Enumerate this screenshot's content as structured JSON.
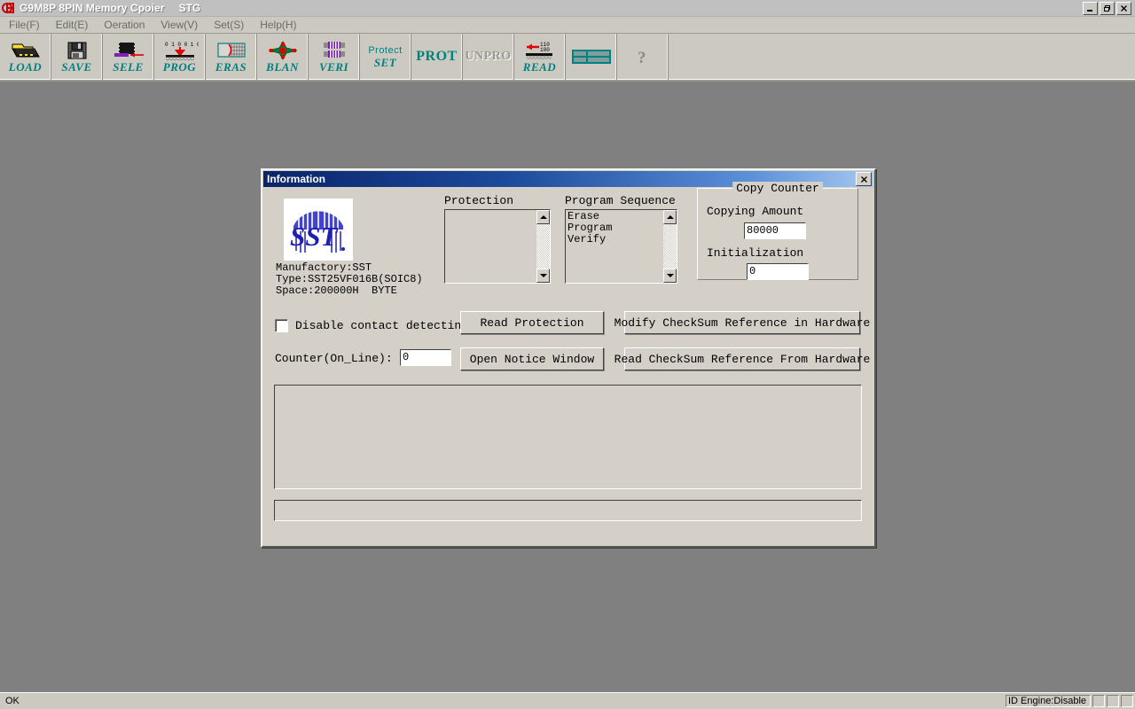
{
  "window": {
    "title": "G9M8P 8PIN Memory Cpoier",
    "subtitle": "STG",
    "app_icon": "app-logo-icon",
    "minimize_label": "_",
    "restore_label": "❐",
    "close_label": "✕"
  },
  "menubar": {
    "items": [
      {
        "label": "File(F)",
        "name": "menu-file"
      },
      {
        "label": "Edit(E)",
        "name": "menu-edit"
      },
      {
        "label": "Oeration",
        "name": "menu-operation"
      },
      {
        "label": "View(V)",
        "name": "menu-view"
      },
      {
        "label": "Set(S)",
        "name": "menu-set"
      },
      {
        "label": "Help(H)",
        "name": "menu-help"
      }
    ]
  },
  "toolbar": {
    "buttons": [
      {
        "label": "LOAD",
        "icon": "folder-open-icon",
        "disabled": false
      },
      {
        "label": "SAVE",
        "icon": "floppy-disk-icon",
        "disabled": false
      },
      {
        "label": "SELE",
        "icon": "chip-select-icon",
        "disabled": false
      },
      {
        "label": "PROG",
        "icon": "program-chip-icon",
        "disabled": false
      },
      {
        "label": "ERAS",
        "icon": "erase-grid-icon",
        "disabled": false
      },
      {
        "label": "BLAN",
        "icon": "blank-check-star-icon",
        "disabled": false
      },
      {
        "label": "VERI",
        "icon": "verify-chips-icon",
        "disabled": false
      },
      {
        "label": "SET",
        "label_top": "Protect",
        "icon": "protect-set-icon",
        "disabled": false
      },
      {
        "label": "PROT",
        "icon": "protect-icon",
        "disabled": false
      },
      {
        "label": "UNPRO",
        "icon": "unprotect-icon",
        "disabled": true
      },
      {
        "label": "READ",
        "icon": "read-chip-icon",
        "disabled": false
      },
      {
        "label": "",
        "icon": "window-tile-icon",
        "disabled": false
      },
      {
        "label": "",
        "icon": "help-question-icon",
        "disabled": false
      }
    ]
  },
  "dialog": {
    "title": "Information",
    "close_label": "✕",
    "device": {
      "logo_text": "SST",
      "logo_name": "sst-logo",
      "manufactory": "Manufactory:SST",
      "type": "Type:SST25VF016B(SOIC8)",
      "space": "Space:200000H  BYTE"
    },
    "protection": {
      "label": "Protection",
      "items": []
    },
    "program_sequence": {
      "label": "Program Sequence",
      "items": [
        "Erase",
        "Program",
        "Verify"
      ]
    },
    "copy_counter": {
      "title": "Copy Counter",
      "copying_amount_label": "Copying Amount",
      "copying_amount_value": "80000",
      "initialization_label": "Initialization",
      "initialization_value": "0"
    },
    "disable_contact": {
      "label": "Disable contact detecting",
      "checked": false
    },
    "counter_online": {
      "label": "Counter(On_Line):",
      "value": "0"
    },
    "buttons": {
      "read_protection": "Read Protection",
      "open_notice_window": "Open  Notice Window",
      "modify_checksum": "Modify CheckSum Reference in Hardware",
      "read_checksum": "Read CheckSum Reference From Hardware"
    },
    "log": {
      "text": ""
    },
    "progress": {
      "text": "",
      "percent": 0
    }
  },
  "statusbar": {
    "message": "OK",
    "id_engine": "ID Engine:Disable",
    "cells": [
      "",
      "",
      ""
    ]
  },
  "colors": {
    "toolbar_label": "#008080",
    "desktop": "#808080",
    "face": "#d4d0c8",
    "titlebar_start": "#0a246a",
    "titlebar_end": "#a6c8f0",
    "sst_blue": "#2020b0"
  }
}
